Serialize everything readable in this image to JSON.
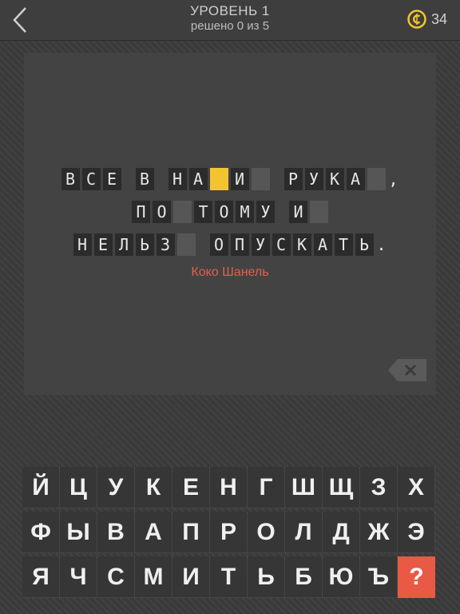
{
  "header": {
    "title": "УРОВЕНЬ 1",
    "subtitle": "решено 0 из 5",
    "coins": "34"
  },
  "quote": {
    "lines": [
      [
        "В",
        "С",
        "Е",
        " ",
        "В",
        " ",
        "Н",
        "А",
        "#sel",
        "И",
        "#empty",
        " ",
        "Р",
        "У",
        "К",
        "А",
        "#empty",
        ","
      ],
      [
        "П",
        "О",
        "#empty",
        "Т",
        "О",
        "М",
        "У",
        " ",
        "И",
        "#empty"
      ],
      [
        "Н",
        "Е",
        "Л",
        "Ь",
        "З",
        "#empty",
        " ",
        "О",
        "П",
        "У",
        "С",
        "К",
        "А",
        "Т",
        "Ь",
        "."
      ]
    ],
    "author": "Коко Шанель"
  },
  "keyboard": {
    "rows": [
      [
        "Й",
        "Ц",
        "У",
        "К",
        "Е",
        "Н",
        "Г",
        "Ш",
        "Щ",
        "З",
        "Х"
      ],
      [
        "Ф",
        "Ы",
        "В",
        "А",
        "П",
        "Р",
        "О",
        "Л",
        "Д",
        "Ж",
        "Э"
      ],
      [
        "Я",
        "Ч",
        "С",
        "М",
        "И",
        "Т",
        "Ь",
        "Б",
        "Ю",
        "Ъ"
      ]
    ],
    "hint_label": "?"
  },
  "colors": {
    "selected_cell": "#f4c430",
    "author": "#e0604c",
    "hint_button": "#e85a45",
    "coin": "#f4c430"
  },
  "icons": {
    "back": "chevron-left-icon",
    "coin": "coin-icon",
    "backspace": "backspace-icon"
  }
}
